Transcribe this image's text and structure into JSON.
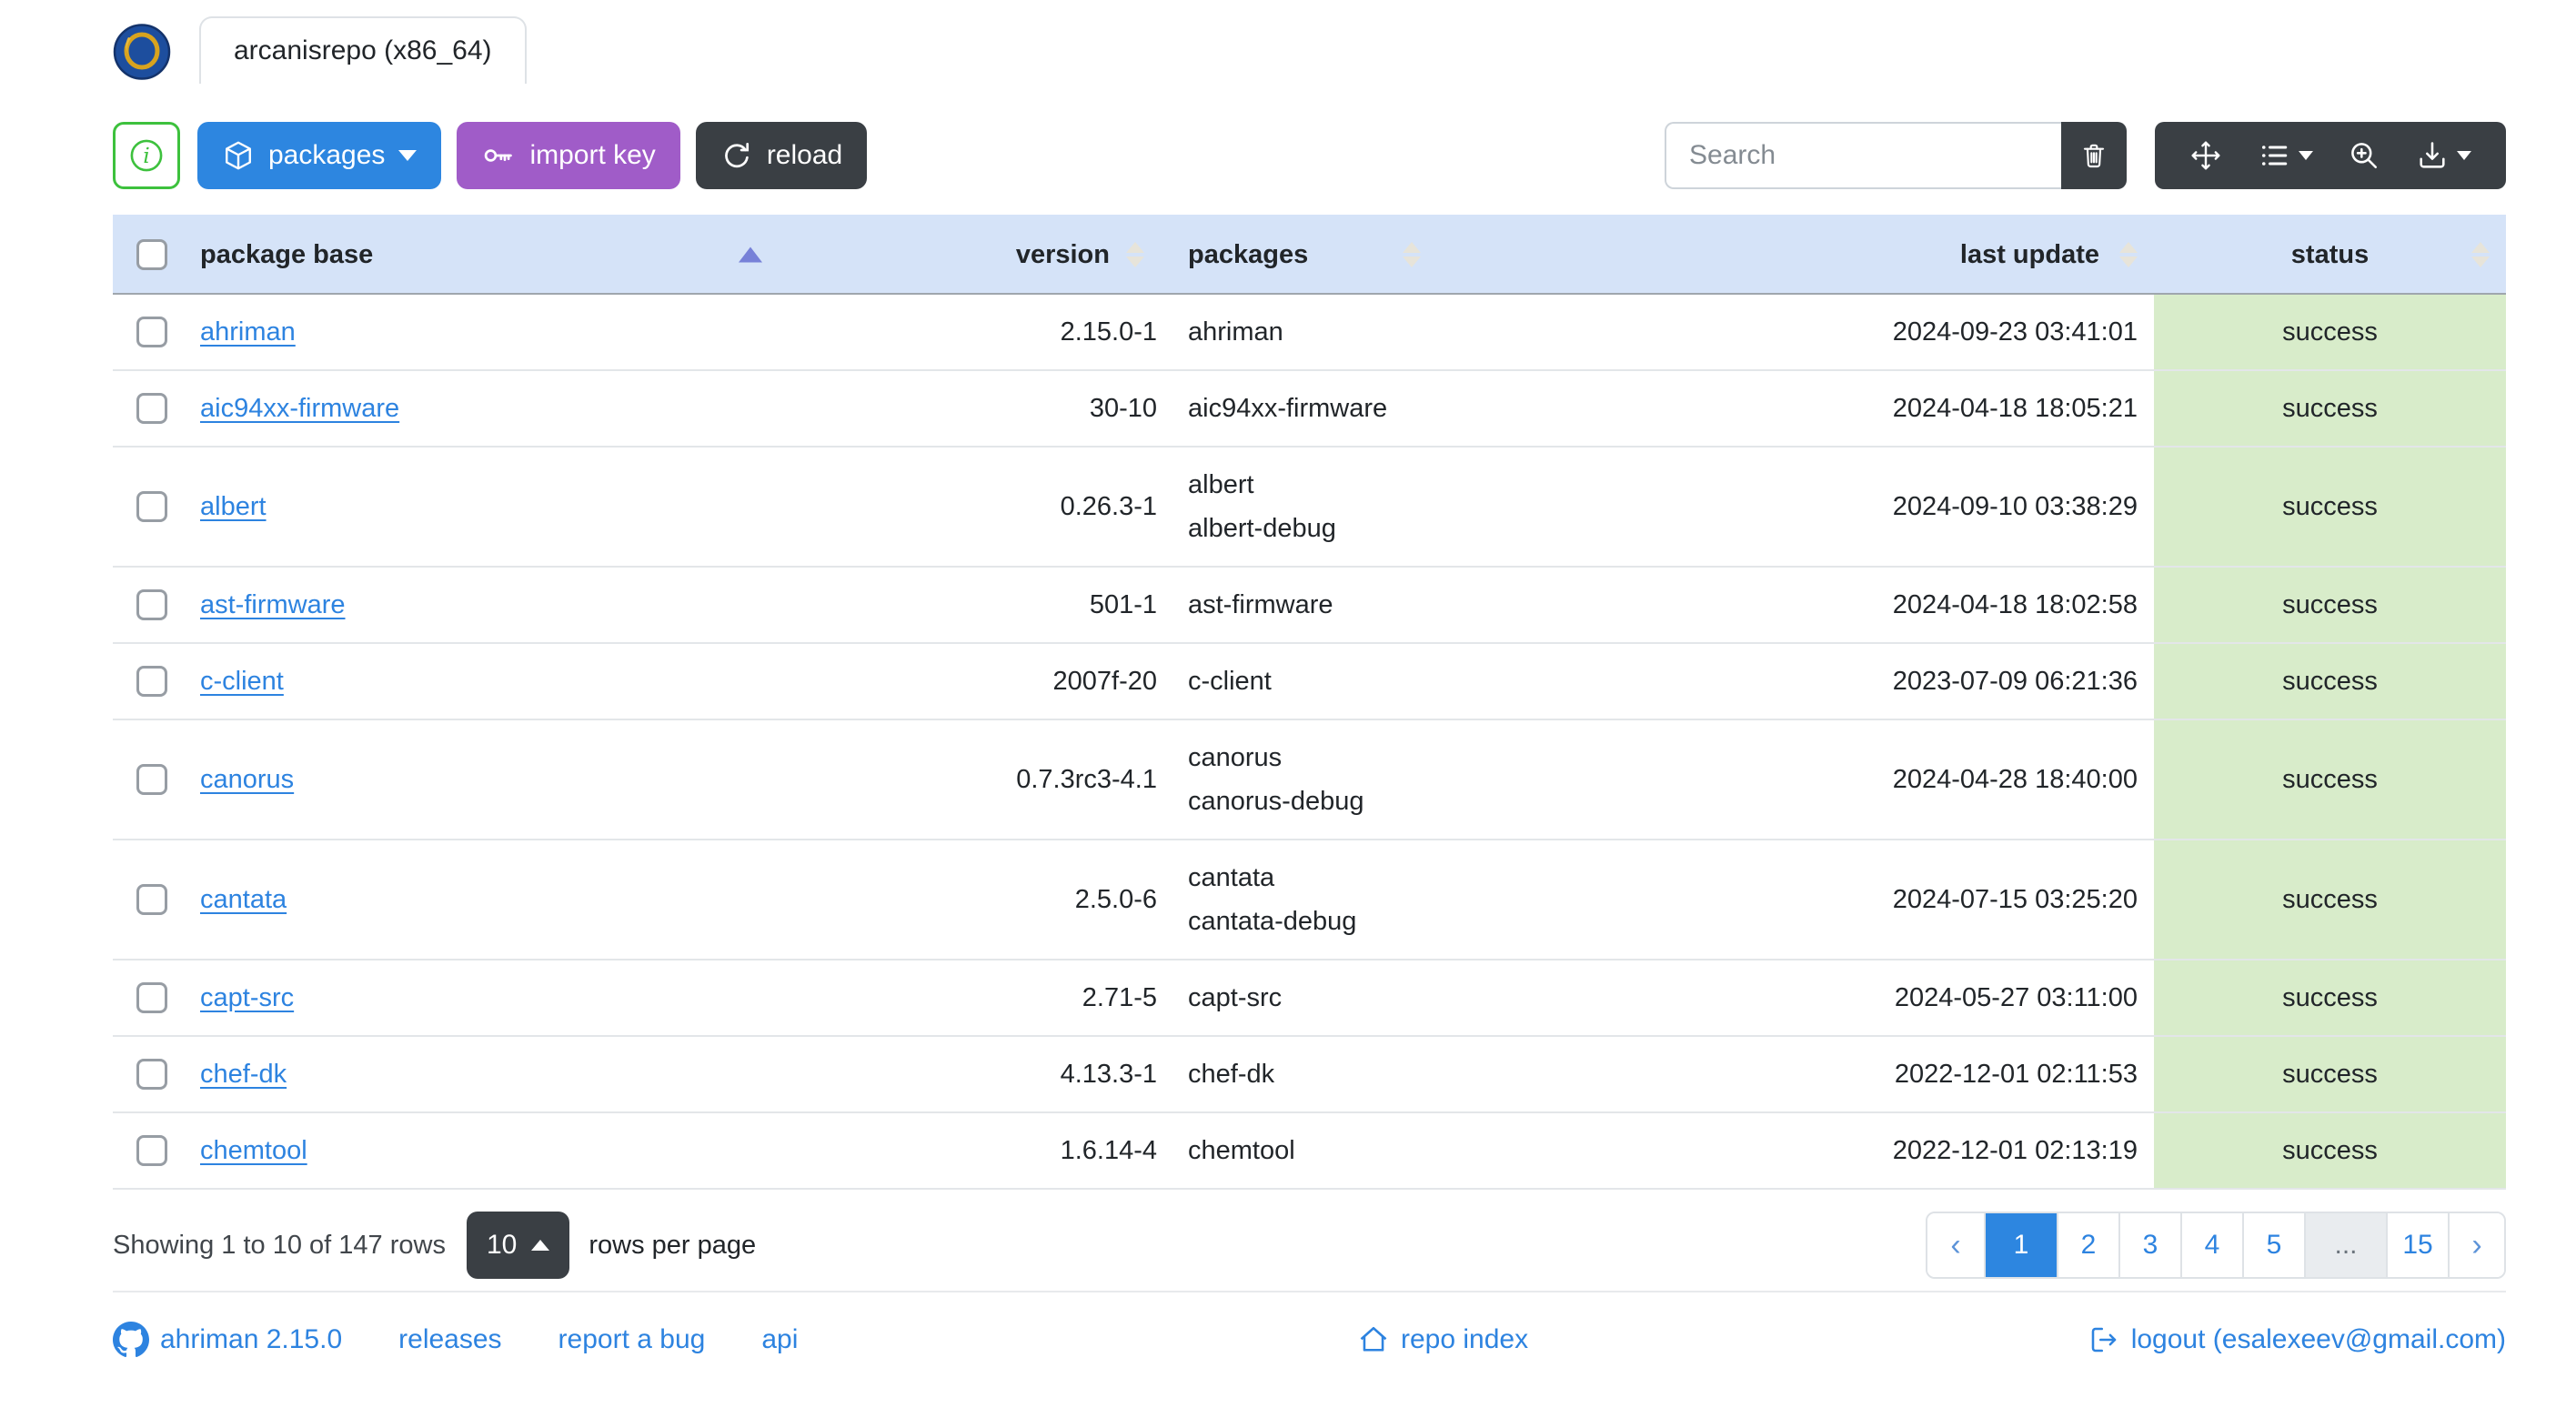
{
  "colors": {
    "primary_blue": "#2d86e0",
    "purple": "#a05cc8",
    "dark": "#3a3f44",
    "info_green": "#3dc13d",
    "link_blue": "#2d83e0",
    "header_bg": "#d5e3f8",
    "status_success_bg": "#d8ecca",
    "sort_active": "#7781d8"
  },
  "header": {
    "logo_icon": "ahriman-logo",
    "tab_title": "arcanisrepo (x86_64)"
  },
  "toolbar": {
    "info_button": {
      "icon": "info-circle-icon"
    },
    "packages_button": {
      "label": "packages",
      "icon": "box-icon"
    },
    "import_key_button": {
      "label": "import key",
      "icon": "key-icon"
    },
    "reload_button": {
      "label": "reload",
      "icon": "reload-icon"
    },
    "search": {
      "placeholder": "Search"
    },
    "clear_search_button": {
      "icon": "trash-icon"
    },
    "table_tools": [
      {
        "icon": "arrows-move-icon"
      },
      {
        "icon": "list-columns-icon"
      },
      {
        "icon": "zoom-in-icon"
      },
      {
        "icon": "download-icon"
      }
    ]
  },
  "table": {
    "columns": [
      {
        "label": "package base",
        "sort": "asc"
      },
      {
        "label": "version",
        "sort": "both"
      },
      {
        "label": "packages",
        "sort": "both"
      },
      {
        "label": "last update",
        "sort": "both"
      },
      {
        "label": "status",
        "sort": "both"
      }
    ],
    "rows": [
      {
        "base": "ahriman",
        "version": "2.15.0-1",
        "packages": [
          "ahriman"
        ],
        "last_update": "2024-09-23 03:41:01",
        "status": "success"
      },
      {
        "base": "aic94xx-firmware",
        "version": "30-10",
        "packages": [
          "aic94xx-firmware"
        ],
        "last_update": "2024-04-18 18:05:21",
        "status": "success"
      },
      {
        "base": "albert",
        "version": "0.26.3-1",
        "packages": [
          "albert",
          "albert-debug"
        ],
        "last_update": "2024-09-10 03:38:29",
        "status": "success"
      },
      {
        "base": "ast-firmware",
        "version": "501-1",
        "packages": [
          "ast-firmware"
        ],
        "last_update": "2024-04-18 18:02:58",
        "status": "success"
      },
      {
        "base": "c-client",
        "version": "2007f-20",
        "packages": [
          "c-client"
        ],
        "last_update": "2023-07-09 06:21:36",
        "status": "success"
      },
      {
        "base": "canorus",
        "version": "0.7.3rc3-4.1",
        "packages": [
          "canorus",
          "canorus-debug"
        ],
        "last_update": "2024-04-28 18:40:00",
        "status": "success"
      },
      {
        "base": "cantata",
        "version": "2.5.0-6",
        "packages": [
          "cantata",
          "cantata-debug"
        ],
        "last_update": "2024-07-15 03:25:20",
        "status": "success"
      },
      {
        "base": "capt-src",
        "version": "2.71-5",
        "packages": [
          "capt-src"
        ],
        "last_update": "2024-05-27 03:11:00",
        "status": "success"
      },
      {
        "base": "chef-dk",
        "version": "4.13.3-1",
        "packages": [
          "chef-dk"
        ],
        "last_update": "2022-12-01 02:11:53",
        "status": "success"
      },
      {
        "base": "chemtool",
        "version": "1.6.14-4",
        "packages": [
          "chemtool"
        ],
        "last_update": "2022-12-01 02:13:19",
        "status": "success"
      }
    ]
  },
  "pagination": {
    "summary": "Showing 1 to 10 of 147 rows",
    "page_size": "10",
    "page_size_suffix": "rows per page",
    "prev_label": "‹",
    "next_label": "›",
    "pages": [
      "1",
      "2",
      "3",
      "4",
      "5",
      "...",
      "15"
    ],
    "active_page": "1"
  },
  "footer": {
    "left_links": [
      {
        "label": "ahriman 2.15.0",
        "icon": "github-icon"
      },
      {
        "label": "releases"
      },
      {
        "label": "report a bug"
      },
      {
        "label": "api"
      }
    ],
    "center_link": {
      "label": "repo index",
      "icon": "home-icon"
    },
    "right_link": {
      "label": "logout (esalexeev@gmail.com)",
      "icon": "logout-icon"
    }
  }
}
